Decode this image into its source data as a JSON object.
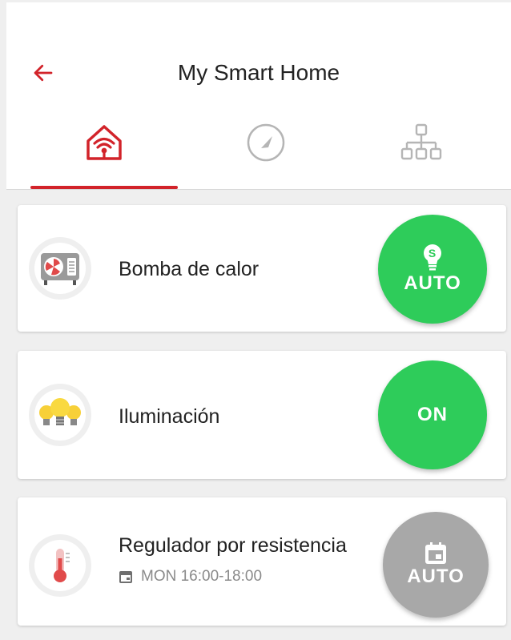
{
  "header": {
    "title": "My Smart Home",
    "accent_color": "#d2232a",
    "back_icon": "arrow-left-icon"
  },
  "tabs": [
    {
      "icon": "smart-home-icon",
      "active": true
    },
    {
      "icon": "gauge-icon",
      "active": false
    },
    {
      "icon": "network-hierarchy-icon",
      "active": false
    }
  ],
  "devices": [
    {
      "name": "Bomba de calor",
      "icon": "heat-pump-icon",
      "mode_label": "AUTO",
      "mode_icon": "lightbulb-dollar-icon",
      "mode_color": "#2ecc5a"
    },
    {
      "name": "Iluminación",
      "icon": "lightbulbs-icon",
      "mode_label": "ON",
      "mode_color": "#2ecc5a"
    },
    {
      "name": "Regulador por resistencia",
      "icon": "thermometer-icon",
      "schedule": "MON 16:00-18:00",
      "schedule_icon": "calendar-icon",
      "mode_label": "AUTO",
      "mode_icon": "calendar-icon",
      "mode_color": "#a8a8a8"
    }
  ]
}
